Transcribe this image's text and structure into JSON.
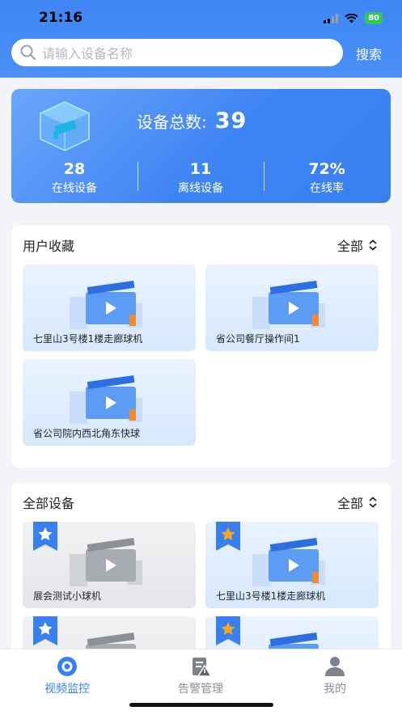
{
  "status_bar": {
    "time": "21:16",
    "battery": "80"
  },
  "search": {
    "placeholder": "请输入设备名称",
    "button_label": "搜索"
  },
  "summary": {
    "total_label": "设备总数:",
    "total_value": "39",
    "stats": [
      {
        "value": "28",
        "label": "在线设备"
      },
      {
        "value": "11",
        "label": "离线设备"
      },
      {
        "value": "72%",
        "label": "在线率"
      }
    ]
  },
  "favorites": {
    "title": "用户收藏",
    "filter": "全部",
    "items": [
      {
        "name": "七里山3号楼1楼走廊球机"
      },
      {
        "name": "省公司餐厅操作间1"
      },
      {
        "name": "省公司院内西北角东快球"
      }
    ]
  },
  "all_devices": {
    "title": "全部设备",
    "filter": "全部",
    "items": [
      {
        "name": "展会测试小球机",
        "status": "offline"
      },
      {
        "name": "七里山3号楼1楼走廊球机",
        "status": "online"
      },
      {
        "name": "",
        "status": "offline"
      },
      {
        "name": "",
        "status": "online"
      }
    ]
  },
  "tabbar": {
    "items": [
      {
        "label": "视频监控",
        "icon": "video-monitor-icon",
        "active": true
      },
      {
        "label": "告警管理",
        "icon": "alarm-icon",
        "active": false
      },
      {
        "label": "我的",
        "icon": "user-icon",
        "active": false
      }
    ]
  },
  "colors": {
    "primary": "#3a7ff0",
    "star_active": "#f5a623",
    "star_inactive": "#ffffff"
  }
}
